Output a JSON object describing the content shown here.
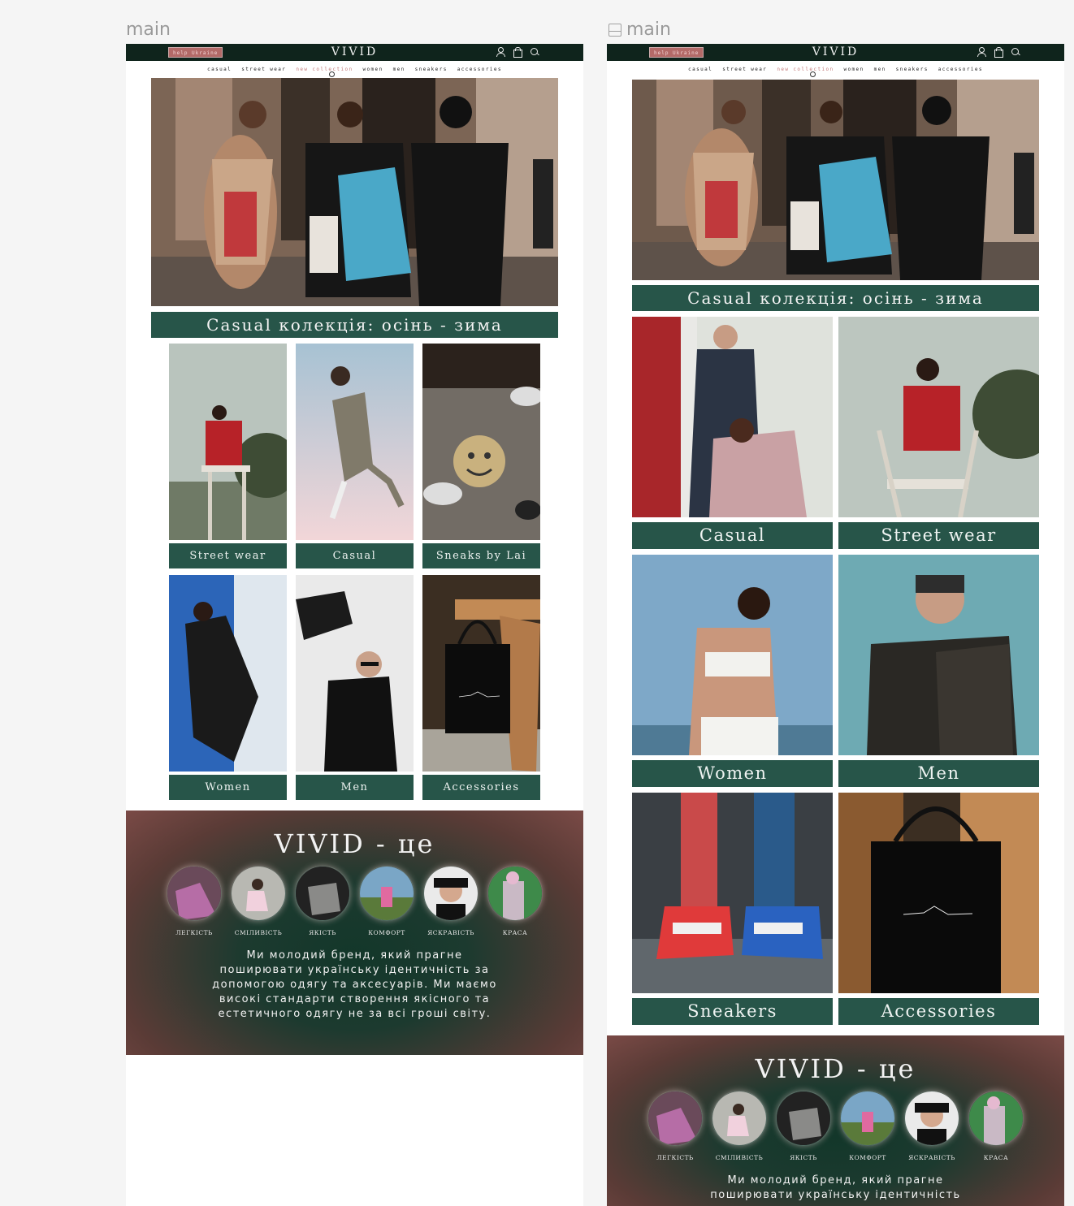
{
  "frames": [
    {
      "label": "main",
      "show_icon": false
    },
    {
      "label": "main",
      "show_icon": true
    }
  ],
  "header": {
    "help_label": "help Ukraine",
    "logo": "VIVID",
    "icons": [
      "user-icon",
      "bag-icon",
      "search-icon"
    ]
  },
  "nav": {
    "items": [
      "casual",
      "street wear",
      "new collection",
      "women",
      "men",
      "sneakers",
      "accessories"
    ],
    "active_index": 2
  },
  "hero": {
    "banner": "Casual колекція: осінь - зима"
  },
  "desktop": {
    "tiles": [
      "Street wear",
      "Casual",
      "Sneaks by Lai",
      "Women",
      "Men",
      "Accessories"
    ]
  },
  "tablet": {
    "tiles": [
      "Casual",
      "Street wear",
      "Women",
      "Men",
      "Sneakers",
      "Accessories"
    ]
  },
  "about": {
    "title": "VIVID - це",
    "values": [
      "ЛЕГКІСТЬ",
      "СМІЛИВІСТЬ",
      "ЯКІСТЬ",
      "КОМФОРТ",
      "ЯСКРАВІСТЬ",
      "КРАСА"
    ],
    "text": "Ми молодий бренд, який прагне поширювати українську ідентичність за допомогою одягу та аксесуарів. Ми маємо високі стандарти створення якісного та естетичного одягу не за всі гроші світу.",
    "text_partial": "Ми молодий бренд, який прагне поширювати українську ідентичність"
  },
  "colors": {
    "dark_green": "#0f241c",
    "accent_green": "#275549",
    "help_red": "#b36a68",
    "active_pink": "#c47a7a"
  }
}
